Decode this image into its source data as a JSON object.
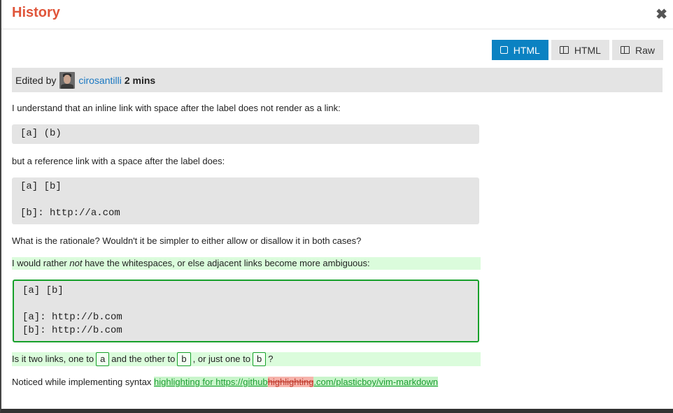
{
  "header": {
    "title": "History"
  },
  "toolbar": [
    {
      "label": "HTML",
      "icon": "square-icon",
      "active": true
    },
    {
      "label": "HTML",
      "icon": "side-by-side-icon",
      "active": false
    },
    {
      "label": "Raw",
      "icon": "side-by-side-icon",
      "active": false
    }
  ],
  "edit": {
    "prefix": "Edited by",
    "user": "cirosantilli",
    "time": "2 mins"
  },
  "content": {
    "p1": "I understand that an inline link with space after the label does not render as a link:",
    "code1": [
      "[a] (b)"
    ],
    "p2": "but a reference link with a space after the label does:",
    "code2": [
      "[a] [b]",
      "",
      "[b]: http://a.com"
    ],
    "p3": "What is the rationale? Wouldn't it be simpler to either allow or disallow it in both cases?",
    "p4_before": "I would rather ",
    "p4_em": "not",
    "p4_after": " have the whitespaces, or else adjacent links become more ambiguous:",
    "code3": [
      "[a] [b]",
      "",
      "[a]: http://b.com",
      "[b]: http://b.com"
    ],
    "p5_a": "Is it two links, one to",
    "p5_box1": "a",
    "p5_b": "and the other to",
    "p5_box2": "b",
    "p5_c": ", or just one to",
    "p5_box3": "b",
    "p5_d": "?",
    "p6_prefix": "Noticed while implementing syntax ",
    "p6_link_a": "highlighting for https://github",
    "p6_deleted": "highlighting",
    "p6_link_b": ".com/plasticboy/vim-markdown"
  }
}
